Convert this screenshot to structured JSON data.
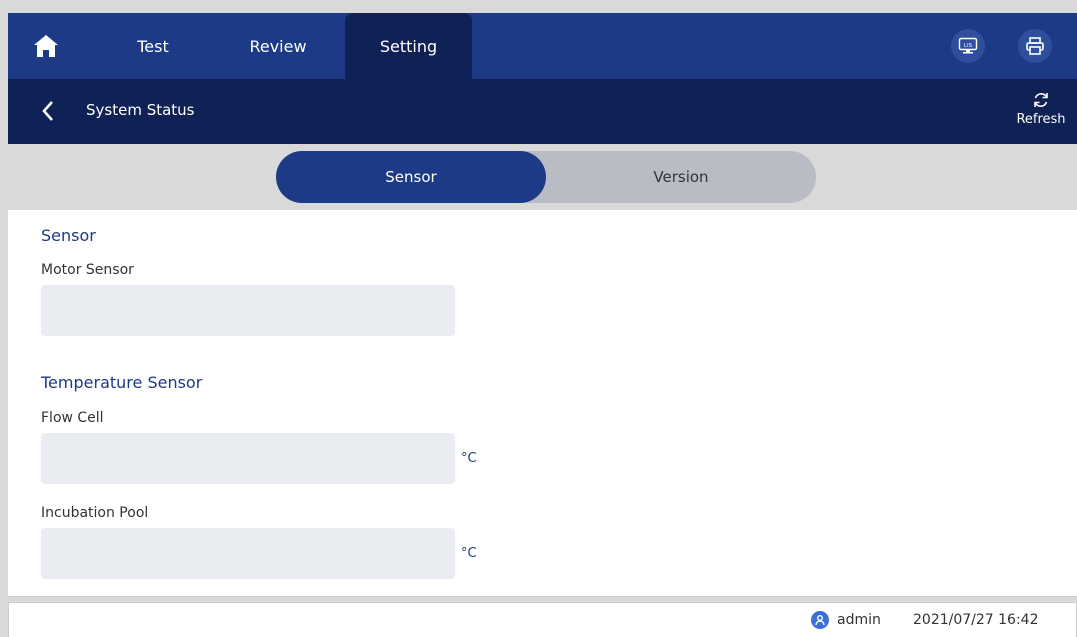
{
  "nav": {
    "tabs": [
      {
        "label": "Test"
      },
      {
        "label": "Review"
      },
      {
        "label": "Setting",
        "active": true
      }
    ],
    "lis_icon_text": "LIS"
  },
  "header": {
    "title": "System Status",
    "refresh_label": "Refresh"
  },
  "segments": [
    {
      "label": "Sensor",
      "active": true
    },
    {
      "label": "Version",
      "active": false
    }
  ],
  "content": {
    "sensor_section": "Sensor",
    "motor_sensor_label": "Motor Sensor",
    "motor_sensor_value": "",
    "temperature_section": "Temperature Sensor",
    "flow_cell_label": "Flow Cell",
    "flow_cell_value": "",
    "flow_cell_unit": "°C",
    "incubation_pool_label": "Incubation Pool",
    "incubation_pool_value": "",
    "incubation_pool_unit": "°C"
  },
  "status": {
    "user": "admin",
    "datetime": "2021/07/27 16:42"
  },
  "colors": {
    "nav_bg": "#1c3a86",
    "header_bg": "#0f2155",
    "accent": "#1c3a86",
    "field_bg": "#e9edf2"
  }
}
